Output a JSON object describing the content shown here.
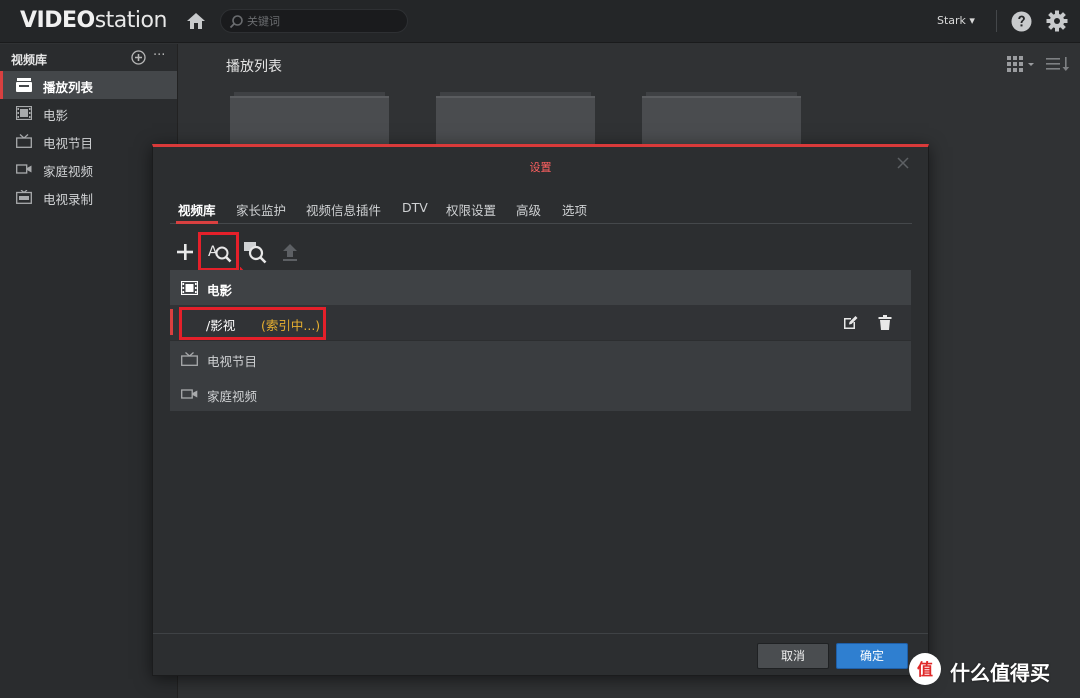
{
  "app": {
    "logo_text_bold": "VIDEO",
    "logo_text_light": "station",
    "search_placeholder": "关键词",
    "user_label": "Stark ▾"
  },
  "sidebar": {
    "header": "视频库",
    "more_label": "···",
    "items": [
      {
        "label": "播放列表",
        "icon": "playlist-icon",
        "active": true
      },
      {
        "label": "电影",
        "icon": "film-icon",
        "active": false
      },
      {
        "label": "电视节目",
        "icon": "tv-icon",
        "active": false
      },
      {
        "label": "家庭视频",
        "icon": "camera-icon",
        "active": false
      },
      {
        "label": "电视录制",
        "icon": "recording-icon",
        "active": false
      }
    ]
  },
  "main": {
    "title": "播放列表"
  },
  "dialog": {
    "title": "设置",
    "tabs": [
      {
        "label": "视频库",
        "active": true
      },
      {
        "label": "家长监护"
      },
      {
        "label": "视频信息插件"
      },
      {
        "label": "DTV"
      },
      {
        "label": "权限设置"
      },
      {
        "label": "高级"
      },
      {
        "label": "选项"
      }
    ],
    "sections": [
      {
        "label": "电影",
        "icon": "film-icon"
      },
      {
        "label": "电视节目",
        "icon": "tv-icon"
      },
      {
        "label": "家庭视频",
        "icon": "camera-icon"
      }
    ],
    "folder_row": {
      "path": "/影视",
      "status": "(索引中...)"
    },
    "buttons": {
      "cancel": "取消",
      "ok": "确定"
    }
  },
  "watermark": {
    "text": "什么值得买",
    "logo_glyph": "值"
  },
  "colors": {
    "accent_red": "#d94040",
    "primary_blue": "#2f7fd0",
    "status_yellow": "#e8b030",
    "annotation_red": "#e5202a"
  }
}
